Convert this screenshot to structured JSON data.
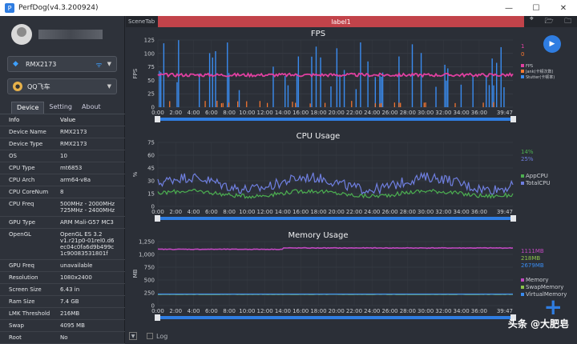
{
  "window": {
    "title": "PerfDog(v4.3.200924)",
    "app_icon": "P"
  },
  "window_controls": {
    "minimize": "—",
    "maximize": "☐",
    "close": "✕"
  },
  "device_select": {
    "value": "RMX2173"
  },
  "app_select": {
    "value": "QQ飞车"
  },
  "tabs": [
    "Device",
    "Setting",
    "About"
  ],
  "info_header": {
    "key": "Info",
    "value": "Value"
  },
  "info_rows": [
    {
      "key": "Device Name",
      "value": "RMX2173"
    },
    {
      "key": "Device Type",
      "value": "RMX2173"
    },
    {
      "key": "OS",
      "value": "10"
    },
    {
      "key": "CPU Type",
      "value": "mt6853"
    },
    {
      "key": "CPU Arch",
      "value": "arm64-v8a"
    },
    {
      "key": "CPU CoreNum",
      "value": "8"
    },
    {
      "key": "CPU Freq",
      "value": "500MHz - 2000MHz\n725MHz - 2400MHz"
    },
    {
      "key": "GPU Type",
      "value": "ARM Mali-G57 MC3"
    },
    {
      "key": "OpenGL",
      "value": "OpenGL ES 3.2\nv1.r21p0-01rel0.d6\nec04c0fa6d9b499c\n1c90083531801f"
    },
    {
      "key": "GPU Freq",
      "value": "unavailable"
    },
    {
      "key": "Resolution",
      "value": "1080x2400"
    },
    {
      "key": "Screen Size",
      "value": "6.43 in"
    },
    {
      "key": "Ram Size",
      "value": "7.4 GB"
    },
    {
      "key": "LMK Threshold",
      "value": "216MB"
    },
    {
      "key": "Swap",
      "value": "4095 MB"
    },
    {
      "key": "Root",
      "value": "No"
    }
  ],
  "scene": {
    "tab_label": "SceneTab",
    "label": "label1"
  },
  "toolbar_icons": [
    "location-icon",
    "folder-open-icon",
    "folder-icon"
  ],
  "bottom": {
    "log_label": "Log"
  },
  "watermark": "头条 @大肥皂",
  "colors": {
    "accent": "#2f7de1",
    "fps": "#e040a0",
    "jank": "#ff7a30",
    "stutter": "#3a8cf0",
    "appcpu": "#4caf50",
    "totalcpu": "#6f7fe0",
    "memory": "#c048c0",
    "swap": "#8bc34a",
    "virtual": "#3a8cf0",
    "label": "#c2434a"
  },
  "chart_data": [
    {
      "type": "line",
      "title": "FPS",
      "ylabel": "FPS",
      "ylim": [
        0,
        125
      ],
      "yticks": [
        0,
        25,
        50,
        75,
        100,
        125
      ],
      "x_ticks": [
        "0:00",
        "2:00",
        "4:00",
        "6:00",
        "8:00",
        "10:00",
        "12:00",
        "14:00",
        "16:00",
        "18:00",
        "20:00",
        "22:00",
        "24:00",
        "26:00",
        "28:00",
        "30:00",
        "32:00",
        "34:00",
        "36:00"
      ],
      "x_end_label": "39:47",
      "series": [
        {
          "name": "FPS",
          "baseline": 60,
          "current": "1"
        },
        {
          "name": "Jank(卡顿次数)",
          "current": "0"
        },
        {
          "name": "Stutter(卡顿率)"
        }
      ]
    },
    {
      "type": "line",
      "title": "CPU Usage",
      "ylabel": "%",
      "ylim": [
        0,
        75
      ],
      "yticks": [
        0,
        15,
        30,
        45,
        60,
        75
      ],
      "x_ticks": [
        "0:00",
        "2:00",
        "4:00",
        "6:00",
        "8:00",
        "10:00",
        "12:00",
        "14:00",
        "16:00",
        "18:00",
        "20:00",
        "22:00",
        "24:00",
        "26:00",
        "28:00",
        "30:00",
        "32:00",
        "34:00",
        "36:00"
      ],
      "x_end_label": "39:47",
      "series": [
        {
          "name": "AppCPU",
          "current": "14%",
          "baseline": 15
        },
        {
          "name": "TotalCPU",
          "current": "25%",
          "baseline": 27
        }
      ]
    },
    {
      "type": "line",
      "title": "Memory Usage",
      "ylabel": "MB",
      "ylim": [
        0,
        1250
      ],
      "yticks": [
        "0",
        "250",
        "500",
        "750",
        "1,000",
        "1,250"
      ],
      "ytick_values": [
        0,
        250,
        500,
        750,
        1000,
        1250
      ],
      "x_ticks": [
        "0:00",
        "2:00",
        "4:00",
        "6:00",
        "8:00",
        "10:00",
        "12:00",
        "14:00",
        "16:00",
        "18:00",
        "20:00",
        "22:00",
        "24:00",
        "26:00",
        "28:00",
        "30:00",
        "32:00",
        "34:00",
        "36:00"
      ],
      "x_end_label": "39:47",
      "series": [
        {
          "name": "Memory",
          "current": "1111MB",
          "baseline": 1100
        },
        {
          "name": "SwapMemory",
          "current": "218MB",
          "baseline": 218
        },
        {
          "name": "VirtualMemory",
          "current": "2679MB",
          "baseline": 2679
        }
      ]
    }
  ]
}
